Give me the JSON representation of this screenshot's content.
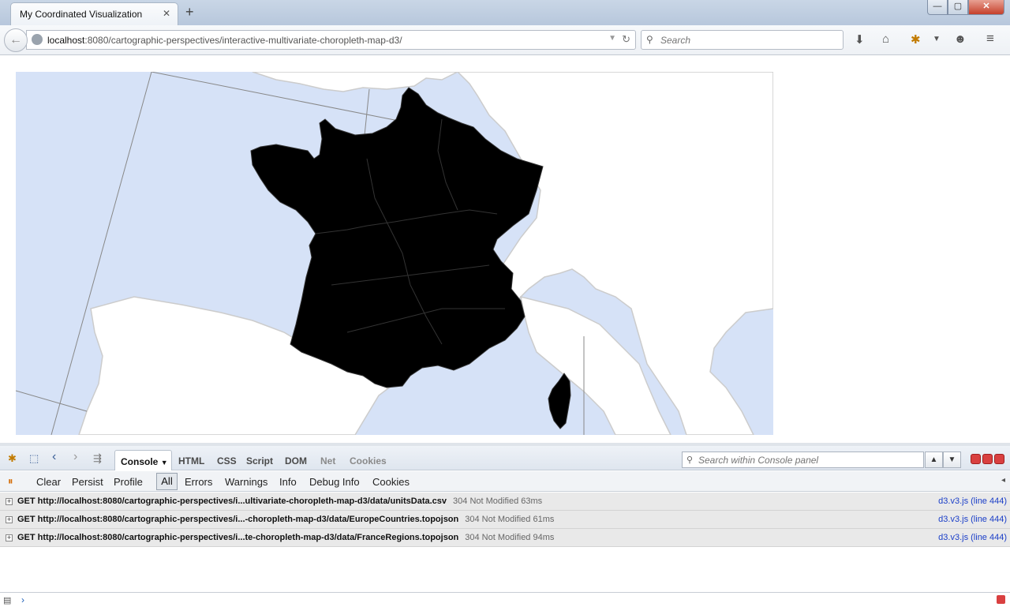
{
  "browser": {
    "tab_title": "My Coordinated Visualization",
    "tab_close": "✕",
    "new_tab": "+",
    "window_controls": {
      "minimize": "—",
      "maximize": "▢",
      "close": "✕"
    },
    "url_host": "localhost",
    "url_rest": ":8080/cartographic-perspectives/interactive-multivariate-choropleth-map-d3/",
    "search_placeholder": "Search",
    "nav_icons": [
      "back-arrow-icon",
      "download-icon",
      "home-icon",
      "firebug-icon",
      "dropdown-icon",
      "smiley-icon",
      "menu-icon"
    ]
  },
  "map": {
    "sea_color": "#d6e2f7",
    "land_color": "#ffffff",
    "border_color": "#cccccc",
    "france_fill": "#000000",
    "graticule_color": "#888888"
  },
  "devtools": {
    "tabs": [
      "HTML",
      "CSS",
      "Script",
      "DOM",
      "Net",
      "Cookies"
    ],
    "active_tab": "Console",
    "search_placeholder": "Search within Console panel",
    "filters": {
      "clear": "Clear",
      "persist": "Persist",
      "profile": "Profile",
      "all": "All",
      "errors": "Errors",
      "warnings": "Warnings",
      "info": "Info",
      "debug_info": "Debug Info",
      "cookies": "Cookies"
    },
    "log": [
      {
        "request": "GET http://localhost:8080/cartographic-perspectives/i...ultivariate-choropleth-map-d3/data/unitsData.csv",
        "status": "304 Not Modified 63ms",
        "source": "d3.v3.js (line 444)"
      },
      {
        "request": "GET http://localhost:8080/cartographic-perspectives/i...-choropleth-map-d3/data/EuropeCountries.topojson",
        "status": "304 Not Modified 61ms",
        "source": "d3.v3.js (line 444)"
      },
      {
        "request": "GET http://localhost:8080/cartographic-perspectives/i...te-choropleth-map-d3/data/FranceRegions.topojson",
        "status": "304 Not Modified 94ms",
        "source": "d3.v3.js (line 444)"
      }
    ],
    "prompt": "›"
  }
}
